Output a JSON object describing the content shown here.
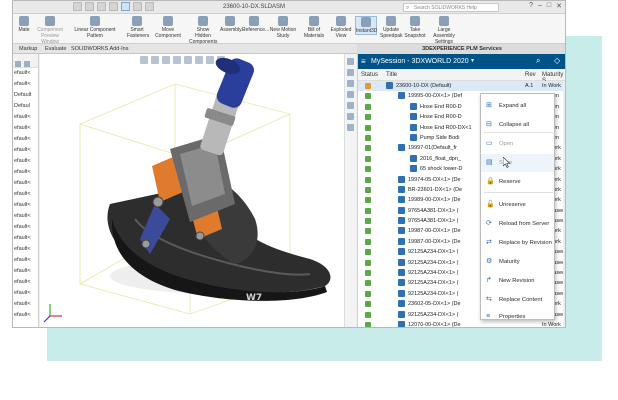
{
  "window": {
    "title": "23600-10-DX.SLDASM",
    "search_placeholder": "Search SOLIDWORKS Help",
    "controls": [
      "?",
      "–",
      "□",
      "✕"
    ]
  },
  "ribbon": {
    "buttons": [
      {
        "label": "Mate",
        "dim": false
      },
      {
        "label": "Component Preview Window",
        "dim": true
      },
      {
        "label": "Linear Component Pattern",
        "dim": false
      },
      {
        "label": "Smart Fasteners",
        "dim": false
      },
      {
        "label": "Move Component",
        "dim": false
      },
      {
        "label": "Show Hidden Components",
        "dim": false
      },
      {
        "label": "Assembly...",
        "dim": false
      },
      {
        "label": "Reference...",
        "dim": false
      },
      {
        "label": "New Motion Study",
        "dim": false
      },
      {
        "label": "Bill of Materials",
        "dim": false
      },
      {
        "label": "Exploded View",
        "dim": false
      },
      {
        "label": "Instant3D",
        "dim": false
      },
      {
        "label": "Update Speedpak",
        "dim": false
      },
      {
        "label": "Take Snapshot",
        "dim": false
      },
      {
        "label": "Large Assembly Settings",
        "dim": false
      }
    ]
  },
  "tabs": [
    "Markup",
    "Evaluate",
    "SOLIDWORKS Add-Ins"
  ],
  "panel_title": "3DEXPERIENCE PLM Services",
  "left_tree": {
    "items": [
      "efault<",
      "efault<",
      "Default",
      "Defaul",
      "efault<",
      "efault<",
      "efault<",
      "efault<",
      "efault<",
      "efault<",
      "efault<",
      "efault<",
      "efault<",
      "efault<",
      "efault<",
      "efault<",
      "efault<",
      "efault<",
      "efault<",
      "efault<",
      "efault<",
      "efault<",
      "efault<"
    ]
  },
  "plm": {
    "session": "MySession - 3DXWORLD 2020",
    "columns": {
      "status": "Status",
      "title": "Title",
      "rev": "Rev",
      "maturity": "Maturity S"
    },
    "rows": [
      {
        "title": "23600-10-DX (Default)",
        "rev": "A.1",
        "maturity": "In Work",
        "indent": 0,
        "lock": true,
        "selected": true
      },
      {
        "title": "19995-00-DX<1> (Def",
        "rev": "",
        "maturity": "Frozen",
        "indent": 1,
        "lock": false,
        "selected": false
      },
      {
        "title": "Hose End R00-D",
        "rev": "",
        "maturity": "Frozen",
        "indent": 2,
        "lock": false,
        "selected": false
      },
      {
        "title": "Hose End R00-D",
        "rev": "",
        "maturity": "Frozen",
        "indent": 2,
        "lock": false,
        "selected": false
      },
      {
        "title": "Hose End R00-DX<1",
        "rev": "",
        "maturity": "Frozen",
        "indent": 2,
        "lock": false,
        "selected": false
      },
      {
        "title": "Pump Side Bodi",
        "rev": "",
        "maturity": "Frozen",
        "indent": 2,
        "lock": false,
        "selected": false
      },
      {
        "title": "19997-01(Default_fr",
        "rev": "",
        "maturity": "In Work",
        "indent": 1,
        "lock": false,
        "selected": false
      },
      {
        "title": "2016_float_dpn_",
        "rev": "",
        "maturity": "In Work",
        "indent": 2,
        "lock": false,
        "selected": false
      },
      {
        "title": "65 shock lower-D",
        "rev": "",
        "maturity": "In Work",
        "indent": 2,
        "lock": false,
        "selected": false
      },
      {
        "title": "19974-05-DX<1> (De",
        "rev": "",
        "maturity": "In Work",
        "indent": 1,
        "lock": false,
        "selected": false
      },
      {
        "title": "BR-23601-DX<1> (De",
        "rev": "",
        "maturity": "In Work",
        "indent": 1,
        "lock": false,
        "selected": false
      },
      {
        "title": "19989-00-DX<1> (De",
        "rev": "",
        "maturity": "In Work",
        "indent": 1,
        "lock": false,
        "selected": false
      },
      {
        "title": "97654A381-DX<1> (",
        "rev": "",
        "maturity": "Released",
        "indent": 1,
        "lock": false,
        "selected": false
      },
      {
        "title": "97654A381-DX<1> (",
        "rev": "",
        "maturity": "Released",
        "indent": 1,
        "lock": false,
        "selected": false
      },
      {
        "title": "19987-00-DX<1> (De",
        "rev": "",
        "maturity": "In Work",
        "indent": 1,
        "lock": false,
        "selected": false
      },
      {
        "title": "19987-00-DX<1> (De",
        "rev": "",
        "maturity": "In Work",
        "indent": 1,
        "lock": false,
        "selected": false
      },
      {
        "title": "92125A234-DX<1> (",
        "rev": "",
        "maturity": "Released",
        "indent": 1,
        "lock": false,
        "selected": false
      },
      {
        "title": "92125A234-DX<1> (",
        "rev": "",
        "maturity": "Released",
        "indent": 1,
        "lock": false,
        "selected": false
      },
      {
        "title": "92125A234-DX<1> (",
        "rev": "",
        "maturity": "Released",
        "indent": 1,
        "lock": false,
        "selected": false
      },
      {
        "title": "92125A234-DX<1> (",
        "rev": "",
        "maturity": "Released",
        "indent": 1,
        "lock": false,
        "selected": false
      },
      {
        "title": "92125A234-DX<1> (",
        "rev": "",
        "maturity": "Released",
        "indent": 1,
        "lock": false,
        "selected": false
      },
      {
        "title": "23602-05-DX<1> (De",
        "rev": "",
        "maturity": "In Work",
        "indent": 1,
        "lock": false,
        "selected": false
      },
      {
        "title": "92125A234-DX<1> (",
        "rev": "",
        "maturity": "Released",
        "indent": 1,
        "lock": false,
        "selected": false
      },
      {
        "title": "12070-00-DX<1> (De",
        "rev": "",
        "maturity": "In Work",
        "indent": 1,
        "lock": false,
        "selected": false
      }
    ]
  },
  "context_menu": {
    "items": [
      {
        "label": "Expand all",
        "icon": "expand-icon",
        "glyph": "⊞",
        "dim": false,
        "hot": false
      },
      {
        "label": "Collapse all",
        "icon": "collapse-icon",
        "glyph": "⊟",
        "dim": false,
        "hot": false
      },
      {
        "label": "Open",
        "icon": "open-icon",
        "glyph": "▭",
        "dim": true,
        "hot": false
      },
      {
        "label": "Save",
        "icon": "save-icon",
        "glyph": "▤",
        "dim": true,
        "hot": true
      },
      {
        "label": "Reserve",
        "icon": "lock-icon",
        "glyph": "🔒",
        "dim": false,
        "hot": false
      },
      {
        "label": "Unreserve",
        "icon": "unlock-icon",
        "glyph": "🔓",
        "dim": false,
        "hot": false
      },
      {
        "label": "Reload from Server",
        "icon": "reload-icon",
        "glyph": "⟳",
        "dim": false,
        "hot": false
      },
      {
        "label": "Replace by Revision",
        "icon": "replace-revision-icon",
        "glyph": "⇄",
        "dim": false,
        "hot": false
      },
      {
        "label": "Maturity",
        "icon": "maturity-icon",
        "glyph": "⚙",
        "dim": false,
        "hot": false
      },
      {
        "label": "New Revision",
        "icon": "new-revision-icon",
        "glyph": "↱",
        "dim": false,
        "hot": false
      },
      {
        "label": "Replace Content",
        "icon": "replace-content-icon",
        "glyph": "⇆",
        "dim": false,
        "hot": false
      },
      {
        "label": "Properties",
        "icon": "properties-icon",
        "glyph": "≡",
        "dim": false,
        "hot": false
      }
    ]
  },
  "colors": {
    "plm_header": "#005386",
    "teal_background": "#c8ece9",
    "part_blue": "#2f6fb3",
    "status_green": "#5aa84a",
    "status_lock": "#e39b2d",
    "reservoir_blue": "#2a3f9c",
    "accent_orange": "#e07b2e"
  }
}
